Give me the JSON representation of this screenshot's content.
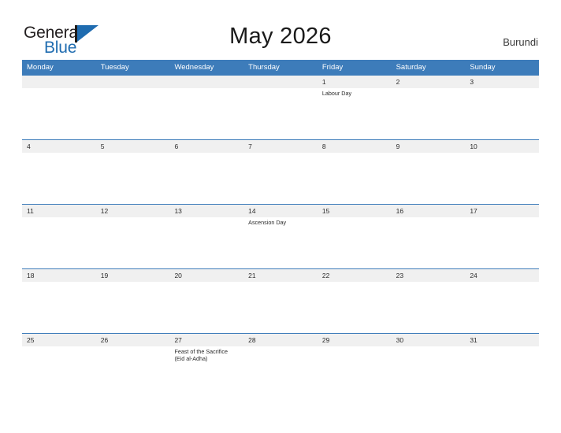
{
  "brand": {
    "word_one": "General",
    "word_two": "Blue",
    "flag_icon": "flag-triangle-icon",
    "accent_color": "#1f6cb0"
  },
  "header": {
    "title": "May 2026",
    "country": "Burundi"
  },
  "colors": {
    "header_blue": "#3d7cba",
    "day_band_gray": "#f0f0f0",
    "text_dark": "#2b2b2b"
  },
  "calendar": {
    "weekdays": [
      "Monday",
      "Tuesday",
      "Wednesday",
      "Thursday",
      "Friday",
      "Saturday",
      "Sunday"
    ],
    "weeks": [
      {
        "days": [
          {
            "num": "",
            "event": ""
          },
          {
            "num": "",
            "event": ""
          },
          {
            "num": "",
            "event": ""
          },
          {
            "num": "",
            "event": ""
          },
          {
            "num": "1",
            "event": "Labour Day"
          },
          {
            "num": "2",
            "event": ""
          },
          {
            "num": "3",
            "event": ""
          }
        ]
      },
      {
        "days": [
          {
            "num": "4",
            "event": ""
          },
          {
            "num": "5",
            "event": ""
          },
          {
            "num": "6",
            "event": ""
          },
          {
            "num": "7",
            "event": ""
          },
          {
            "num": "8",
            "event": ""
          },
          {
            "num": "9",
            "event": ""
          },
          {
            "num": "10",
            "event": ""
          }
        ]
      },
      {
        "days": [
          {
            "num": "11",
            "event": ""
          },
          {
            "num": "12",
            "event": ""
          },
          {
            "num": "13",
            "event": ""
          },
          {
            "num": "14",
            "event": "Ascension Day"
          },
          {
            "num": "15",
            "event": ""
          },
          {
            "num": "16",
            "event": ""
          },
          {
            "num": "17",
            "event": ""
          }
        ]
      },
      {
        "days": [
          {
            "num": "18",
            "event": ""
          },
          {
            "num": "19",
            "event": ""
          },
          {
            "num": "20",
            "event": ""
          },
          {
            "num": "21",
            "event": ""
          },
          {
            "num": "22",
            "event": ""
          },
          {
            "num": "23",
            "event": ""
          },
          {
            "num": "24",
            "event": ""
          }
        ]
      },
      {
        "days": [
          {
            "num": "25",
            "event": ""
          },
          {
            "num": "26",
            "event": ""
          },
          {
            "num": "27",
            "event": "Feast of the Sacrifice (Eid al-Adha)"
          },
          {
            "num": "28",
            "event": ""
          },
          {
            "num": "29",
            "event": ""
          },
          {
            "num": "30",
            "event": ""
          },
          {
            "num": "31",
            "event": ""
          }
        ]
      }
    ]
  }
}
